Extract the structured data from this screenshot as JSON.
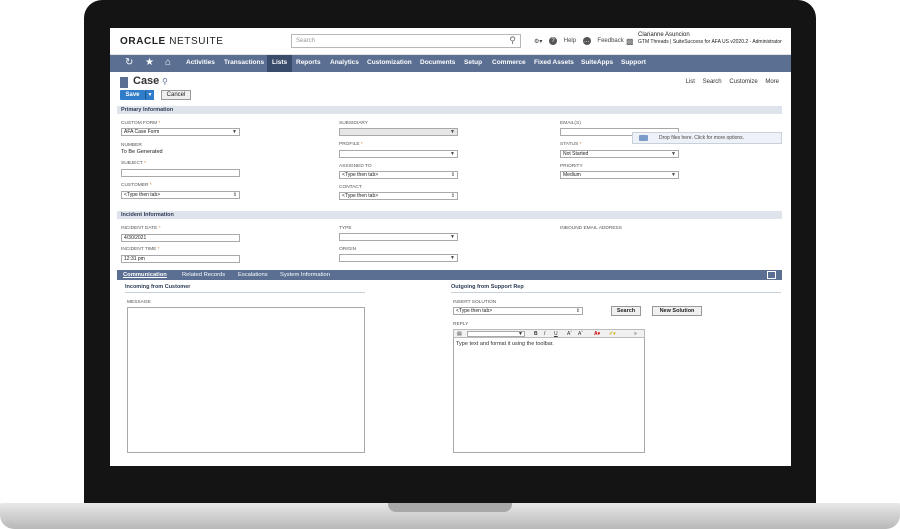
{
  "header": {
    "logo_bold": "ORACLE",
    "logo_rest": "NETSUITE",
    "search_placeholder": "Search",
    "help": "Help",
    "feedback": "Feedback",
    "user_name": "Clarianne Asuncion",
    "user_role": "GTM Threads | SuiteSuccess for AFA US v2020.2 - Administrator"
  },
  "nav": {
    "items": [
      "Activities",
      "Transactions",
      "Lists",
      "Reports",
      "Analytics",
      "Customization",
      "Documents",
      "Setup",
      "Commerce",
      "Fixed Assets",
      "SuiteApps",
      "Support"
    ],
    "active": "Lists"
  },
  "page": {
    "title": "Case",
    "links": [
      "List",
      "Search",
      "Customize",
      "More"
    ],
    "save_label": "Save",
    "cancel_label": "Cancel"
  },
  "primary": {
    "section_title": "Primary Information",
    "custom_form_label": "CUSTOM FORM",
    "custom_form_value": "AFA Case Form",
    "number_label": "NUMBER",
    "number_value": "To Be Generated",
    "subject_label": "SUBJECT",
    "customer_label": "CUSTOMER",
    "customer_value": "<Type then tab>",
    "subsidiary_label": "SUBSIDIARY",
    "profile_label": "PROFILE",
    "assigned_label": "ASSIGNED TO",
    "assigned_value": "<Type then tab>",
    "contact_label": "CONTACT",
    "contact_value": "<Type then tab>",
    "emails_label": "EMAIL(S)",
    "dropzone_text": "Drop files here. Click for more options.",
    "status_label": "STATUS",
    "status_value": "Not Started",
    "priority_label": "PRIORITY",
    "priority_value": "Medium"
  },
  "incident": {
    "section_title": "Incident Information",
    "date_label": "INCIDENT DATE",
    "date_value": "4/30/2021",
    "time_label": "INCIDENT TIME",
    "time_value": "12:31 pm",
    "type_label": "TYPE",
    "origin_label": "ORIGIN",
    "inbound_label": "INBOUND EMAIL ADDRESS"
  },
  "tabs": [
    "Communication",
    "Related Records",
    "Escalations",
    "System Information"
  ],
  "communication": {
    "incoming_title": "Incoming from Customer",
    "message_label": "MESSAGE",
    "outgoing_title": "Outgoing from Support Rep",
    "insert_solution_label": "INSERT SOLUTION",
    "insert_solution_value": "<Type then tab>",
    "search_button": "Search",
    "new_solution_button": "New Solution",
    "reply_label": "REPLY",
    "reply_placeholder": "Type text and format it using the toolbar."
  },
  "colors": {
    "nav_bg": "#5a6f92",
    "nav_active": "#394c6b",
    "save_blue": "#2f7cc9",
    "section_bg": "#dfe4ec",
    "required": "#e06e0d"
  }
}
